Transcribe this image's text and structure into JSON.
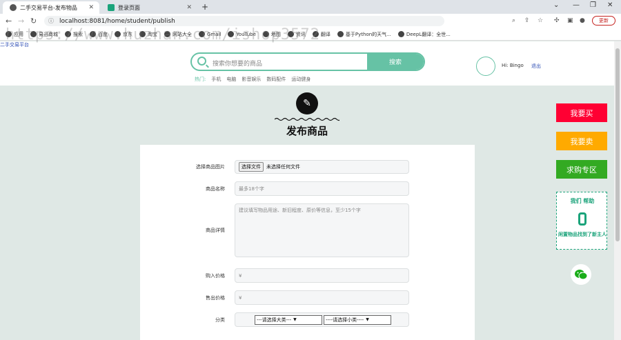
{
  "browser": {
    "tabs": [
      {
        "title": "二手交易平台-发布物品",
        "active": true
      },
      {
        "title": "登录页面",
        "active": false
      }
    ],
    "url": "localhost:8081/home/student/publish",
    "update_label": "更新",
    "bookmarks": [
      "应用",
      "易迅商城",
      "搜索",
      "百度",
      "京东",
      "淘宝",
      "网站大全",
      "Gmail",
      "YouTube",
      "地图",
      "资讯",
      "翻译",
      "基于Python的天气...",
      "DeepL翻译：全世..."
    ]
  },
  "watermark": "https://www.huzhan.com/ishop3572",
  "header": {
    "logo_alt": "二手交易平台",
    "search_placeholder": "搜索你想要的商品",
    "search_button": "搜索",
    "hot_label": "热门:",
    "hot_items": [
      "手机",
      "电脑",
      "影音娱乐",
      "数码配件",
      "运动健身"
    ],
    "greeting": "Hi:",
    "username": "Bingo",
    "logout": "退出"
  },
  "page_title": "发布商品",
  "form": {
    "image_label": "选择商品图片",
    "file_button": "选择文件",
    "file_status": "未选择任何文件",
    "name_label": "商品名称",
    "name_placeholder": "最多18个字",
    "detail_label": "商品详情",
    "detail_placeholder": "建议填写物品用途、新旧程度、原价等信息，至少15个字",
    "buy_price_label": "购入价格",
    "sell_price_label": "售出价格",
    "currency": "¥",
    "category_label": "分类",
    "category_major": "---请选择大类---",
    "category_minor": "----请选择小类----"
  },
  "side": {
    "buy": "我要买",
    "sell": "我要卖",
    "want": "求购专区",
    "help_title": "我们 帮助",
    "help_count": "0",
    "help_sub": "闲置物品找到了新主人",
    "colors": {
      "buy": "#ff0033",
      "sell": "#ffaa00",
      "want": "#33aa22",
      "accent": "#66c2a5"
    }
  }
}
